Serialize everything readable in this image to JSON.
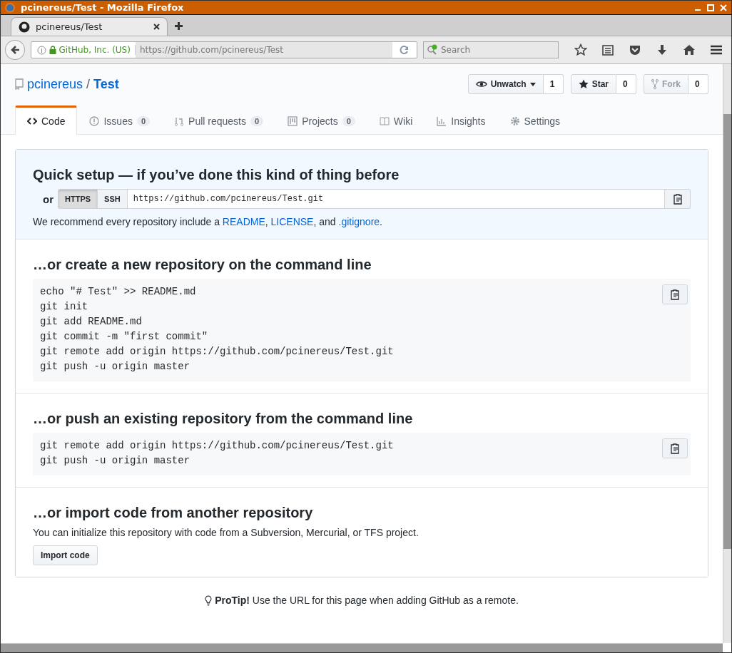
{
  "window": {
    "title": "pcinereus/Test - Mozilla Firefox"
  },
  "browser_tab": {
    "title": "pcinereus/Test",
    "selected": true
  },
  "nav": {
    "identity": "GitHub, Inc. (US)",
    "url": "https://github.com/pcinereus/Test",
    "search": {
      "placeholder": "Search"
    }
  },
  "repo": {
    "owner": "pcinereus",
    "separator": "/",
    "name": "Test"
  },
  "repo_actions": [
    {
      "kind": "watch",
      "label": "Unwatch",
      "count": "1",
      "disabled": false
    },
    {
      "kind": "star",
      "label": "Star",
      "count": "0",
      "disabled": false
    },
    {
      "kind": "fork",
      "label": "Fork",
      "count": "0",
      "disabled": true
    }
  ],
  "repo_tabs": [
    {
      "kind": "code",
      "label": "Code",
      "selected": true
    },
    {
      "kind": "issues",
      "label": "Issues",
      "count": "0",
      "selected": false
    },
    {
      "kind": "pulls",
      "label": "Pull requests",
      "count": "0",
      "selected": false
    },
    {
      "kind": "projects",
      "label": "Projects",
      "count": "0",
      "selected": false
    },
    {
      "kind": "wiki",
      "label": "Wiki",
      "selected": false
    },
    {
      "kind": "insights",
      "label": "Insights",
      "selected": false
    },
    {
      "kind": "settings",
      "label": "Settings",
      "selected": false
    }
  ],
  "quick_setup": {
    "heading": "Quick setup — if you’ve done this kind of thing before",
    "or_label": "or",
    "protocols": [
      {
        "label": "HTTPS",
        "selected": true
      },
      {
        "label": "SSH",
        "selected": false
      }
    ],
    "clone_url": "https://github.com/pcinereus/Test.git",
    "recommend": [
      {
        "kind": "text",
        "text": "We recommend every repository include a "
      },
      {
        "kind": "link",
        "text": "README"
      },
      {
        "kind": "text",
        "text": ", "
      },
      {
        "kind": "link",
        "text": "LICENSE"
      },
      {
        "kind": "text",
        "text": ", and "
      },
      {
        "kind": "link",
        "text": ".gitignore"
      },
      {
        "kind": "text",
        "text": "."
      }
    ]
  },
  "sections": [
    {
      "heading": "…or create a new repository on the command line",
      "lines": [
        "echo \"# Test\" >> README.md",
        "git init",
        "git add README.md",
        "git commit -m \"first commit\"",
        "git remote add origin https://github.com/pcinereus/Test.git",
        "git push -u origin master"
      ]
    },
    {
      "heading": "…or push an existing repository from the command line",
      "lines": [
        "git remote add origin https://github.com/pcinereus/Test.git",
        "git push -u origin master"
      ]
    }
  ],
  "import": {
    "heading": "…or import code from another repository",
    "description": "You can initialize this repository with code from a Subversion, Mercurial, or TFS project.",
    "button": "Import code"
  },
  "protip": "**ProTip!** Use the URL for this page when adding GitHub as a remote."
}
